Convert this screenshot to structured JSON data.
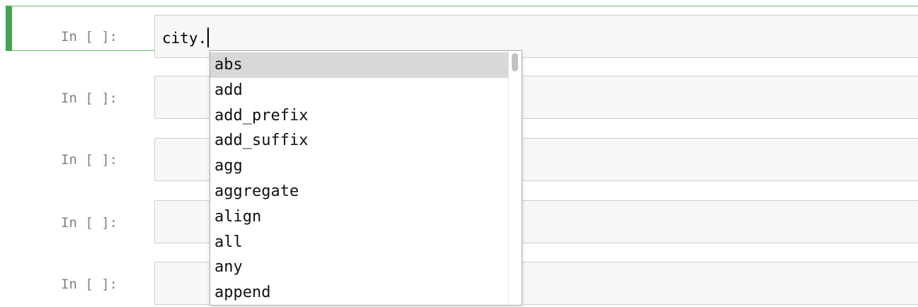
{
  "cells": [
    {
      "prompt": "In [ ]:",
      "code": "city.",
      "selected": true
    },
    {
      "prompt": "In [ ]:",
      "code": ""
    },
    {
      "prompt": "In [ ]:",
      "code": ""
    },
    {
      "prompt": "In [ ]:",
      "code": ""
    },
    {
      "prompt": "In [ ]:",
      "code": ""
    }
  ],
  "completer": {
    "selected_item": "abs",
    "items": [
      "abs",
      "add",
      "add_prefix",
      "add_suffix",
      "agg",
      "aggregate",
      "align",
      "all",
      "any",
      "append"
    ]
  },
  "colors": {
    "selected_cell_accent": "#42a552",
    "selected_cell_border": "#66bb6a",
    "input_background": "#f7f7f7",
    "completer_highlight": "#d8d8d8"
  }
}
